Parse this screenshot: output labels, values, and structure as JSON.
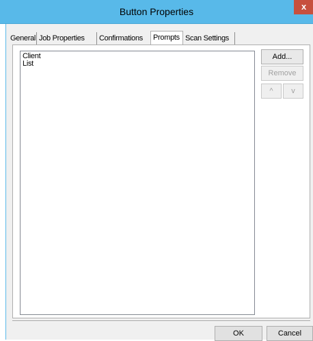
{
  "window": {
    "title": "Button Properties",
    "close_glyph": "x"
  },
  "tabs": [
    {
      "label": "General",
      "active": false
    },
    {
      "label": "Job Properties",
      "active": false
    },
    {
      "label": "Confirmations",
      "active": false
    },
    {
      "label": "Prompts",
      "active": true
    },
    {
      "label": "Scan Settings",
      "active": false
    }
  ],
  "prompts_list": {
    "items": [
      "Client",
      "List"
    ]
  },
  "side_buttons": {
    "add": "Add...",
    "remove": "Remove",
    "up": "^",
    "down": "v"
  },
  "dialog_buttons": {
    "ok": "OK",
    "cancel": "Cancel"
  },
  "colors": {
    "titlebar": "#58b9e9",
    "close_button": "#c7503e",
    "dialog_background": "#f0f0f0"
  }
}
